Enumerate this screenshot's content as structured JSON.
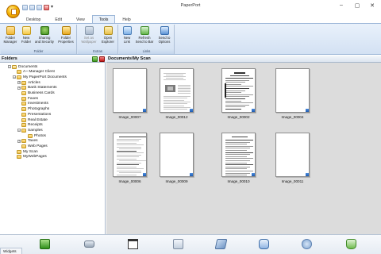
{
  "window": {
    "title": "PaperPort",
    "minimize": "–",
    "maximize": "▢",
    "close": "✕",
    "qat_dropdown": "▾"
  },
  "ribbon": {
    "tabs": [
      {
        "label": "Desktop"
      },
      {
        "label": "Edit"
      },
      {
        "label": "View"
      },
      {
        "label": "Tools",
        "active": true
      },
      {
        "label": "Help"
      }
    ],
    "groups": [
      {
        "label": "Folder",
        "buttons": [
          {
            "line1": "Folder",
            "line2": "Manager",
            "icon": "folder-manager-icon"
          },
          {
            "line1": "New",
            "line2": "Folder",
            "icon": "new-folder-icon"
          },
          {
            "line1": "Sharing",
            "line2": "and Security",
            "icon": "sharing-icon"
          },
          {
            "line1": "Folder",
            "line2": "Properties",
            "icon": "folder-properties-icon"
          }
        ]
      },
      {
        "label": "Extras",
        "buttons": [
          {
            "line1": "Set as",
            "line2": "Wallpaper",
            "icon": "wallpaper-icon",
            "disabled": true
          },
          {
            "line1": "Open",
            "line2": "Explorer",
            "icon": "explorer-icon"
          }
        ]
      },
      {
        "label": "Links",
        "buttons": [
          {
            "line1": "New",
            "line2": "Link",
            "icon": "new-link-icon"
          },
          {
            "line1": "Refresh",
            "line2": "Send to Bar",
            "icon": "refresh-icon"
          },
          {
            "line1": "Send to",
            "line2": "Options",
            "icon": "send-to-icon"
          }
        ]
      }
    ]
  },
  "folders_pane": {
    "title": "Folders",
    "tree": [
      {
        "label": "Documents",
        "level": 0,
        "expander": "–"
      },
      {
        "label": "A~ Manager Client",
        "level": 1,
        "expander": ""
      },
      {
        "label": "My PaperPort Documents",
        "level": 1,
        "expander": "–"
      },
      {
        "label": "Articles",
        "level": 2,
        "expander": "+"
      },
      {
        "label": "Bank Statements",
        "level": 2,
        "expander": "+"
      },
      {
        "label": "Business Cards",
        "level": 2,
        "expander": ""
      },
      {
        "label": "Faxes",
        "level": 2,
        "expander": ""
      },
      {
        "label": "Investments",
        "level": 2,
        "expander": ""
      },
      {
        "label": "Photographs",
        "level": 2,
        "expander": ""
      },
      {
        "label": "Presentations",
        "level": 2,
        "expander": ""
      },
      {
        "label": "Real Estate",
        "level": 2,
        "expander": ""
      },
      {
        "label": "Receipts",
        "level": 2,
        "expander": ""
      },
      {
        "label": "Samples",
        "level": 2,
        "expander": "–"
      },
      {
        "label": "Photos",
        "level": 3,
        "expander": ""
      },
      {
        "label": "Taxes",
        "level": 2,
        "expander": "+"
      },
      {
        "label": "Web Pages",
        "level": 2,
        "expander": ""
      },
      {
        "label": "My Scan",
        "level": 1,
        "expander": ""
      },
      {
        "label": "MyWebPages",
        "level": 1,
        "expander": ""
      }
    ]
  },
  "main_pane": {
    "title": "Documents\\My Scan",
    "items": [
      {
        "caption": "Image_00007",
        "style": "blank"
      },
      {
        "caption": "Image_00012",
        "style": "photo-doc"
      },
      {
        "caption": "Image_00002",
        "style": "form"
      },
      {
        "caption": "Image_00004",
        "style": "blank"
      },
      {
        "caption": "Image_00006",
        "style": "text"
      },
      {
        "caption": "Image_00009",
        "style": "blank"
      },
      {
        "caption": "Image_00010",
        "style": "text-dense"
      },
      {
        "caption": "Image_00011",
        "style": "blank"
      }
    ]
  },
  "widgets": {
    "tab_label": "Widgets",
    "icons": [
      "green-widget-icon",
      "scanner-icon",
      "window-icon",
      "calculator-icon",
      "pen-icon",
      "fax-icon",
      "network-icon",
      "recycle-icon"
    ]
  }
}
